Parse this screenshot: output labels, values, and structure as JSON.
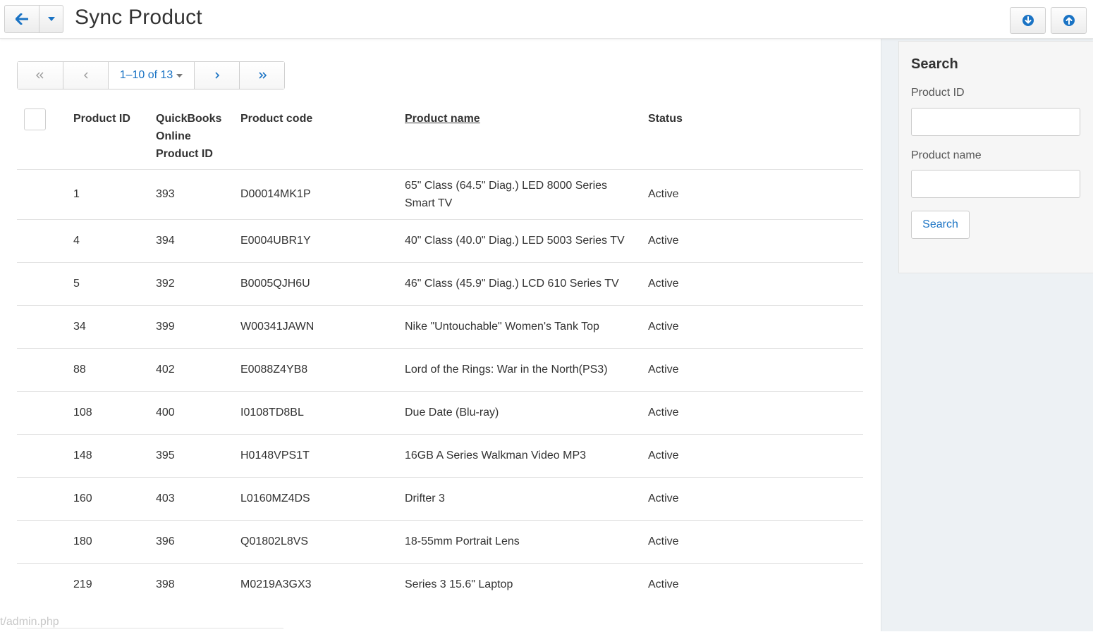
{
  "header": {
    "title": "Sync Product",
    "back_icon": "arrow-left-icon",
    "dropdown_icon": "caret-down-icon",
    "download_icon": "circle-arrow-down-icon",
    "upload_icon": "circle-arrow-up-icon",
    "accent_color": "#1a73c4"
  },
  "pagination": {
    "range_label": "1–10 of 13",
    "first_icon": "double-chevron-left-icon",
    "prev_icon": "chevron-left-icon",
    "next_icon": "chevron-right-icon",
    "last_icon": "double-chevron-right-icon"
  },
  "table": {
    "columns": {
      "product_id": "Product ID",
      "qbo_line1": "QuickBooks",
      "qbo_line2": "Online",
      "qbo_line3": "Product ID",
      "product_code": "Product code",
      "product_name": "Product name",
      "status": "Status"
    },
    "rows": [
      {
        "product_id": "1",
        "qbo_id": "393",
        "code": "D00014MK1P",
        "name": "65\" Class (64.5\" Diag.) LED 8000 Series Smart TV",
        "status": "Active"
      },
      {
        "product_id": "4",
        "qbo_id": "394",
        "code": "E0004UBR1Y",
        "name": "40\" Class (40.0\" Diag.) LED 5003 Series TV",
        "status": "Active"
      },
      {
        "product_id": "5",
        "qbo_id": "392",
        "code": "B0005QJH6U",
        "name": "46\" Class (45.9\" Diag.) LCD 610 Series TV",
        "status": "Active"
      },
      {
        "product_id": "34",
        "qbo_id": "399",
        "code": "W00341JAWN",
        "name": "Nike \"Untouchable\" Women's Tank Top",
        "status": "Active"
      },
      {
        "product_id": "88",
        "qbo_id": "402",
        "code": "E0088Z4YB8",
        "name": "Lord of the Rings: War in the North(PS3)",
        "status": "Active"
      },
      {
        "product_id": "108",
        "qbo_id": "400",
        "code": "I0108TD8BL",
        "name": "Due Date (Blu-ray)",
        "status": "Active"
      },
      {
        "product_id": "148",
        "qbo_id": "395",
        "code": "H0148VPS1T",
        "name": "16GB A Series Walkman Video MP3",
        "status": "Active"
      },
      {
        "product_id": "160",
        "qbo_id": "403",
        "code": "L0160MZ4DS",
        "name": "Drifter 3",
        "status": "Active"
      },
      {
        "product_id": "180",
        "qbo_id": "396",
        "code": "Q01802L8VS",
        "name": "18-55mm Portrait Lens",
        "status": "Active"
      },
      {
        "product_id": "219",
        "qbo_id": "398",
        "code": "M0219A3GX3",
        "name": "Series 3 15.6\" Laptop",
        "status": "Active"
      }
    ]
  },
  "search_panel": {
    "title": "Search",
    "product_id_label": "Product ID",
    "product_id_value": "",
    "product_name_label": "Product name",
    "product_name_value": "",
    "search_button": "Search"
  },
  "status_bar": {
    "url": "t/admin.php"
  }
}
